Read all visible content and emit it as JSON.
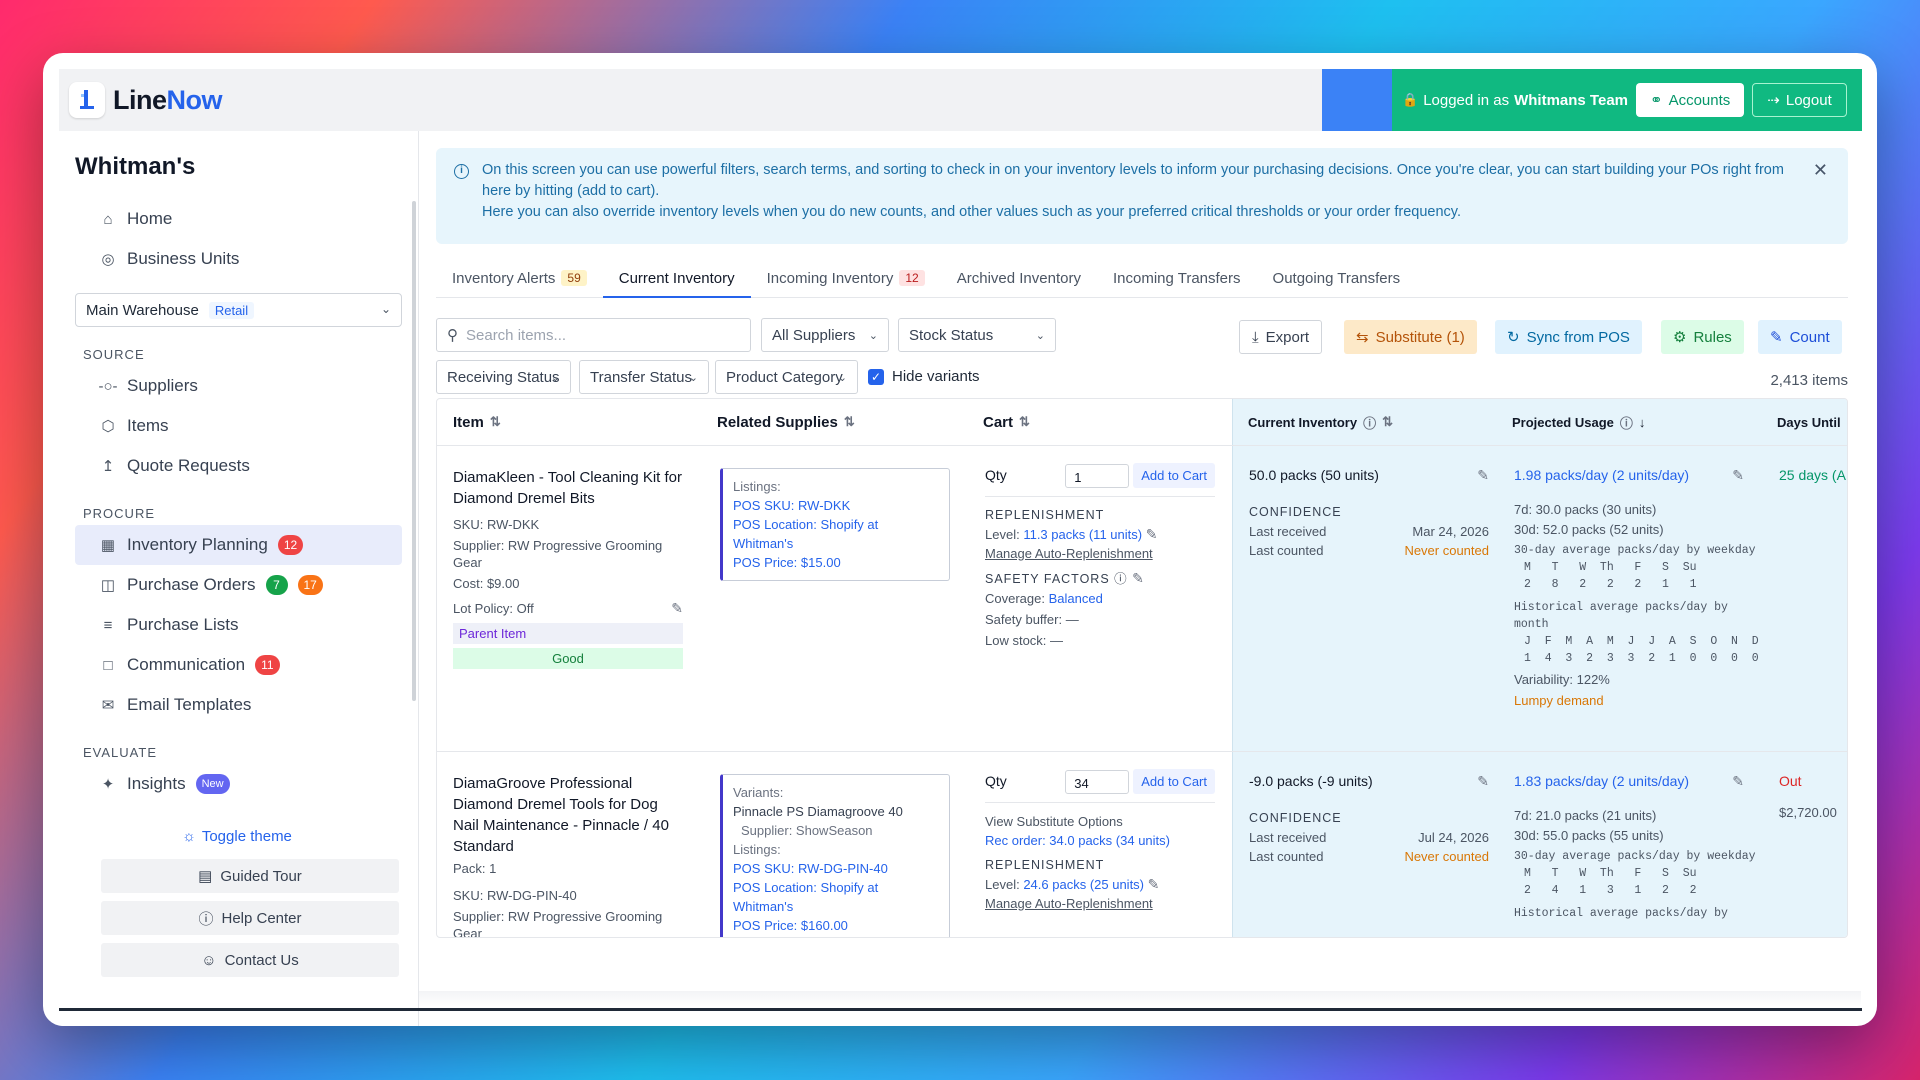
{
  "app": {
    "name_part1": "Line",
    "name_part2": "Now",
    "logged_prefix": "Logged in as",
    "user": "Whitmans Team",
    "accounts": "Accounts",
    "logout": "Logout"
  },
  "sidebar": {
    "org": "Whitman's",
    "top_items": [
      {
        "label": "Home",
        "icon": "home-icon"
      },
      {
        "label": "Business Units",
        "icon": "globe-icon"
      }
    ],
    "warehouse": {
      "name": "Main Warehouse",
      "tag": "Retail"
    },
    "source_label": "SOURCE",
    "source": [
      "Suppliers",
      "Items",
      "Quote Requests"
    ],
    "procure_label": "PROCURE",
    "procure": [
      {
        "label": "Inventory Planning",
        "badge": "12"
      },
      {
        "label": "Purchase Orders",
        "badge1": "7",
        "badge2": "17"
      },
      {
        "label": "Purchase Lists"
      },
      {
        "label": "Communication",
        "badge": "11"
      },
      {
        "label": "Email Templates"
      }
    ],
    "evaluate_label": "EVALUATE",
    "insights": "Insights",
    "insights_badge": "New",
    "toggle_theme": "Toggle theme",
    "guided_tour": "Guided Tour",
    "help_center": "Help Center",
    "contact_us": "Contact Us"
  },
  "info": {
    "line1": "On this screen you can use powerful filters, search terms, and sorting to check in on your inventory levels to inform your purchasing decisions. Once you're clear, you can start building your POs right from here by hitting (add to cart).",
    "line2": "Here you can also override inventory levels when you do new counts, and other values such as your preferred critical thresholds or your order frequency."
  },
  "tabs": [
    {
      "label": "Inventory Alerts",
      "badge": "59"
    },
    {
      "label": "Current Inventory"
    },
    {
      "label": "Incoming Inventory",
      "badge": "12"
    },
    {
      "label": "Archived Inventory"
    },
    {
      "label": "Incoming Transfers"
    },
    {
      "label": "Outgoing Transfers"
    }
  ],
  "filters": {
    "search_placeholder": "Search items...",
    "suppliers": "All Suppliers",
    "stock_status": "Stock Status",
    "receiving": "Receiving Status",
    "transfer": "Transfer Status",
    "category": "Product Category",
    "hide_variants": "Hide variants",
    "count": "2,413 items"
  },
  "actions": {
    "export": "Export",
    "substitute": "Substitute (1)",
    "sync": "Sync from POS",
    "rules": "Rules",
    "count": "Count"
  },
  "columns": {
    "item": "Item",
    "related": "Related Supplies",
    "cart": "Cart",
    "current": "Current Inventory",
    "projected": "Projected Usage",
    "days": "Days Until"
  },
  "row1": {
    "title": "DiamaKleen - Tool Cleaning Kit for Diamond Dremel Bits",
    "sku": "SKU: RW-DKK",
    "supplier": "Supplier: RW Progressive Grooming Gear",
    "cost": "Cost: $9.00",
    "lot": "Lot Policy: Off",
    "parent": "Parent Item",
    "good": "Good",
    "listings_label": "Listings:",
    "pos_sku": "POS SKU: RW-DKK",
    "pos_loc": "POS Location: Shopify at Whitman's",
    "pos_price": "POS Price: $15.00",
    "qty_label": "Qty",
    "qty": "1",
    "add": "Add to Cart",
    "repl_label": "REPLENISHMENT",
    "level_prefix": "Level:",
    "level": "11.3 packs (11 units)",
    "manage": "Manage Auto-Replenishment",
    "safety_label": "SAFETY FACTORS",
    "coverage_prefix": "Coverage:",
    "coverage": "Balanced",
    "buffer": "Safety buffer: —",
    "low": "Low stock: —",
    "current": "50.0 packs (50 units)",
    "conf_label": "CONFIDENCE",
    "last_received_label": "Last received",
    "last_received": "Mar 24, 2026",
    "last_counted_label": "Last counted",
    "last_counted": "Never counted",
    "usage": "1.98 packs/day (2 units/day)",
    "d7": "7d: 30.0 packs (30 units)",
    "d30": "30d: 52.0 packs (52 units)",
    "weekday_title": "30-day average packs/day by weekday",
    "weekday_days": "M   T   W  Th   F   S  Su",
    "weekday_vals": "2   8   2   2   2   1   1",
    "month_title": "Historical average packs/day by month",
    "month_labels": "J  F  M  A  M  J  J  A  S  O  N  D",
    "month_vals": "1  4  3  2  3  3  2  1  0  0  0  0",
    "variability": "Variability: 122%",
    "lumpy": "Lumpy demand",
    "days": "25 days (A"
  },
  "row2": {
    "title": "DiamaGroove Professional Diamond Dremel Tools for Dog Nail Maintenance - Pinnacle / 40 Standard",
    "pack": "Pack: 1",
    "sku": "SKU: RW-DG-PIN-40",
    "supplier": "Supplier: RW Progressive Grooming Gear",
    "variants_label": "Variants:",
    "variant": "Pinnacle PS Diamagroove 40",
    "variant_supplier": "Supplier: ShowSeason",
    "listings_label": "Listings:",
    "pos_sku": "POS SKU: RW-DG-PIN-40",
    "pos_loc": "POS Location: Shopify at Whitman's",
    "pos_price": "POS Price: $160.00",
    "qty_label": "Qty",
    "qty": "34",
    "add": "Add to Cart",
    "view_sub": "View Substitute Options",
    "rec": "Rec order: 34.0 packs (34 units)",
    "repl_label": "REPLENISHMENT",
    "level_prefix": "Level:",
    "level": "24.6 packs (25 units)",
    "manage": "Manage Auto-Replenishment",
    "current": "-9.0 packs (-9 units)",
    "conf_label": "CONFIDENCE",
    "last_received_label": "Last received",
    "last_received": "Jul 24, 2026",
    "last_counted_label": "Last counted",
    "last_counted": "Never counted",
    "usage": "1.83 packs/day (2 units/day)",
    "d7": "7d: 21.0 packs (21 units)",
    "d30": "30d: 55.0 packs (55 units)",
    "weekday_title": "30-day average packs/day by weekday",
    "weekday_days": "M   T   W  Th   F   S  Su",
    "weekday_vals": "2   4   1   3   1   2   2",
    "hist_cut": "Historical average packs/day by",
    "days": "Out",
    "days_value": "$2,720.00"
  }
}
